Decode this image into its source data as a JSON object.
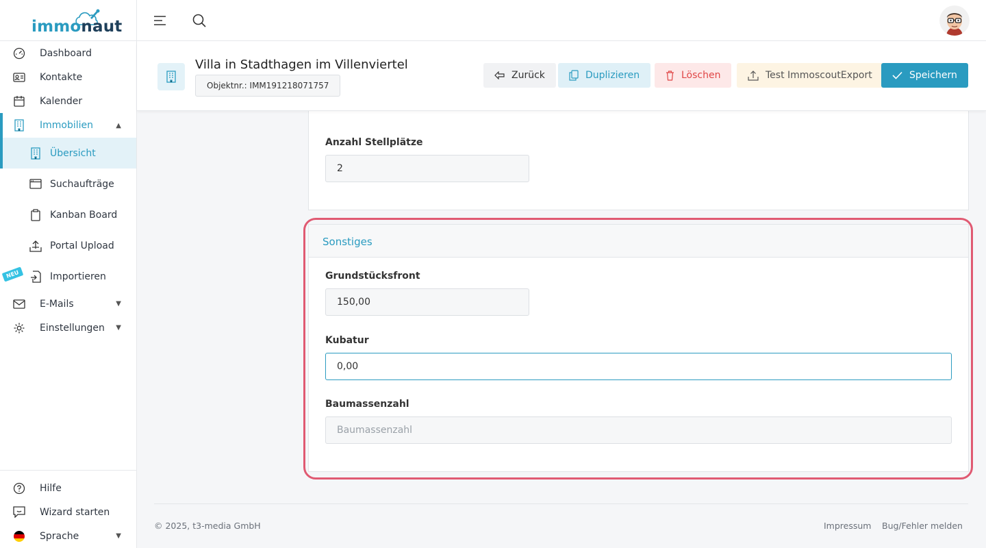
{
  "logo": {
    "part1": "immo",
    "part2": "naut"
  },
  "sidebar": {
    "items": [
      {
        "label": "Dashboard"
      },
      {
        "label": "Kontakte"
      },
      {
        "label": "Kalender"
      },
      {
        "label": "Immobilien"
      },
      {
        "label": "Übersicht"
      },
      {
        "label": "Suchaufträge"
      },
      {
        "label": "Kanban Board"
      },
      {
        "label": "Portal Upload"
      },
      {
        "label": "Importieren",
        "badge": "NEU"
      },
      {
        "label": "E-Mails"
      },
      {
        "label": "Einstellungen"
      }
    ],
    "bottom": [
      {
        "label": "Hilfe"
      },
      {
        "label": "Wizard starten"
      },
      {
        "label": "Sprache"
      }
    ]
  },
  "header": {
    "title": "Villa in Stadthagen im Villenviertel",
    "objektnr": "Objektnr.: IMM191218071757",
    "buttons": {
      "back": "Zurück",
      "duplicate": "Duplizieren",
      "delete": "Löschen",
      "test_export": "Test ImmoscoutExport",
      "save": "Speichern"
    }
  },
  "form": {
    "stellplaetze": {
      "label": "Anzahl Stellplätze",
      "value": "2"
    },
    "sonstiges": {
      "title": "Sonstiges",
      "grundstuecksfront": {
        "label": "Grundstücksfront",
        "value": "150,00"
      },
      "kubatur": {
        "label": "Kubatur",
        "value": "0,00"
      },
      "baumassenzahl": {
        "label": "Baumassenzahl",
        "placeholder": "Baumassenzahl"
      }
    }
  },
  "footer": {
    "copyright": "© 2025, t3-media GmbH",
    "impressum": "Impressum",
    "bug": "Bug/Fehler melden"
  },
  "colors": {
    "accent": "#2a9bc0",
    "danger": "#e04646",
    "highlight": "#e05a72"
  }
}
